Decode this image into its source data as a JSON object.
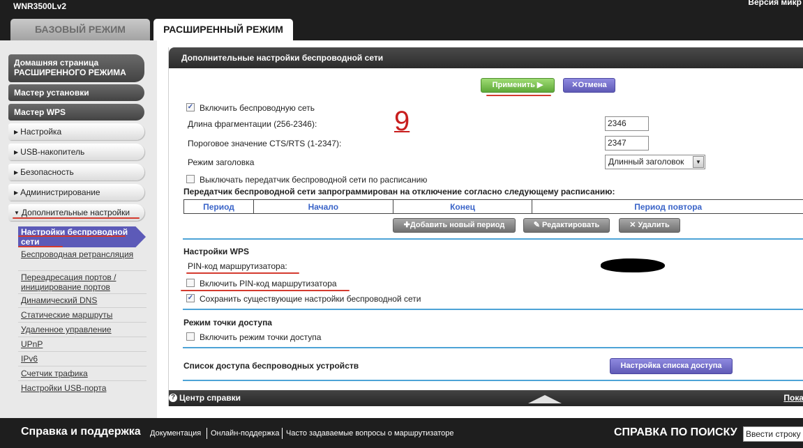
{
  "header": {
    "model": "WNR3500Lv2",
    "firmware_partial": "Версия микр",
    "tabs": {
      "basic": "БАЗОВЫЙ РЕЖИМ",
      "advanced": "РАСШИРЕННЫЙ РЕЖИМ"
    }
  },
  "sidebar": {
    "home": "Домашняя страница РАСШИРЕННОГО РЕЖИМА",
    "setup_wizard": "Мастер установки",
    "wps_wizard": "Мастер WPS",
    "sections": [
      "Настройка",
      "USB-накопитель",
      "Безопасность",
      "Администрирование",
      "Дополнительные настройки"
    ],
    "active_item": "Настройки беспроводной сети",
    "links": [
      "Беспроводная ретрансляция",
      "Переадресация портов / инициирование портов",
      "Динамический DNS",
      "Статические маршруты",
      "Удаленное управление",
      "UPnP",
      "IPv6",
      "Счетчик трафика",
      "Настройки USB-порта"
    ]
  },
  "content": {
    "title": "Дополнительные настройки беспроводной сети",
    "apply": "Применить ▶",
    "cancel": "✕Отмена",
    "annotation": "9",
    "enable_wireless": "Включить беспроводную сеть",
    "frag_label": "Длина фрагментации (256-2346):",
    "frag_value": "2346",
    "cts_label": "Пороговое значение CTS/RTS (1-2347):",
    "cts_value": "2347",
    "preamble_label": "Режим заголовка",
    "preamble_value": "Длинный заголовок",
    "schedule_off": "Выключать передатчик беспроводной сети по расписанию",
    "schedule_heading": "Передатчик беспроводной сети запрограммирован на отключение согласно следующему расписанию:",
    "table_headers": [
      "Период",
      "Начало",
      "Конец",
      "Период повтора"
    ],
    "add_period": "✚Добавить новый период",
    "edit": "✎ Редактировать",
    "delete": "✕ Удалить",
    "wps_heading": "Настройки WPS",
    "pin_label": "PIN-код маршрутизатора:",
    "enable_pin": "Включить PIN-код маршрутизатора",
    "keep_settings": "Сохранить существующие настройки беспроводной сети",
    "ap_heading": "Режим точки доступа",
    "enable_ap": "Включить режим точки доступа",
    "acl_heading": "Список доступа беспроводных устройств",
    "acl_button": "Настройка списка доступа",
    "help_center": "Центр справки",
    "show_partial": "Пока"
  },
  "footer": {
    "support_title": "Справка и поддержка",
    "links": [
      "Документация",
      "Онлайн-поддержка",
      "Часто задаваемые вопросы о маршрутизаторе"
    ],
    "search_title": "СПРАВКА ПО ПОИСКУ",
    "search_placeholder": "Ввести строку"
  },
  "colors": {
    "accent_purple": "#5c5ab8",
    "apply_green": "#6fba45",
    "annotation_red": "#c81e1e",
    "divider_blue": "#4da3d6"
  }
}
